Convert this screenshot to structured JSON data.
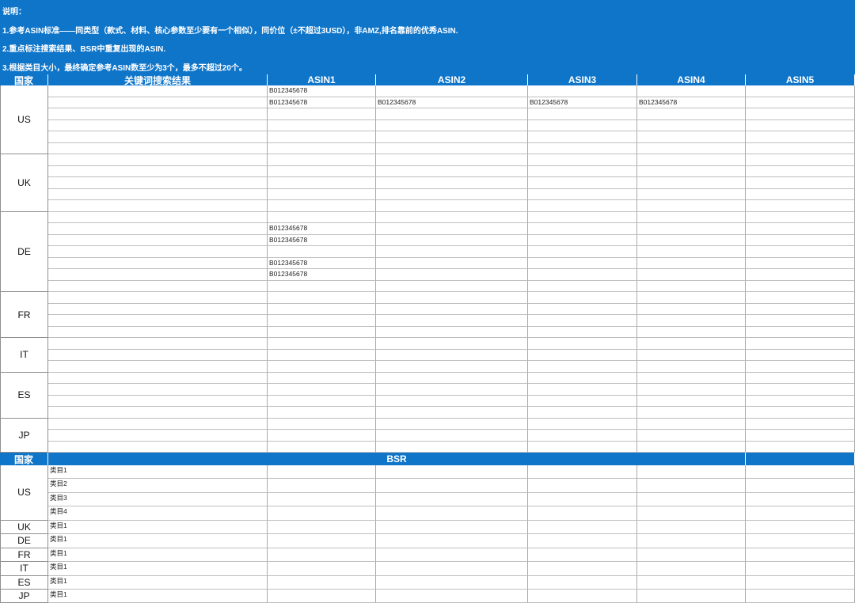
{
  "notes": {
    "title": "说明：",
    "line1": "1.参考ASIN标准——同类型（款式、材料、核心参数至少要有一个相似），同价位（±不超过3USD），非AMZ,排名靠前的优秀ASIN.",
    "line2": "2.重点标注搜索结果、BSR中重复出现的ASIN.",
    "line3": "3.根据类目大小，最终确定参考ASIN数至少为3个，最多不超过20个。"
  },
  "table1": {
    "headers": [
      "国家",
      "关键词搜索结果",
      "ASIN1",
      "ASIN2",
      "ASIN3",
      "ASIN4",
      "ASIN5"
    ],
    "groups": [
      {
        "country": "US",
        "rows": [
          [
            "",
            "B012345678",
            "",
            "",
            "",
            ""
          ],
          [
            "",
            "B012345678",
            "B012345678",
            "B012345678",
            "B012345678",
            ""
          ],
          [
            "",
            "",
            "",
            "",
            "",
            ""
          ],
          [
            "",
            "",
            "",
            "",
            "",
            ""
          ],
          [
            "",
            "",
            "",
            "",
            "",
            ""
          ],
          [
            "",
            "",
            "",
            "",
            "",
            ""
          ]
        ]
      },
      {
        "country": "UK",
        "rows": [
          [
            "",
            "",
            "",
            "",
            "",
            ""
          ],
          [
            "",
            "",
            "",
            "",
            "",
            ""
          ],
          [
            "",
            "",
            "",
            "",
            "",
            ""
          ],
          [
            "",
            "",
            "",
            "",
            "",
            ""
          ],
          [
            "",
            "",
            "",
            "",
            "",
            ""
          ]
        ]
      },
      {
        "country": "DE",
        "rows": [
          [
            "",
            "",
            "",
            "",
            "",
            ""
          ],
          [
            "",
            "B012345678",
            "",
            "",
            "",
            ""
          ],
          [
            "",
            "B012345678",
            "",
            "",
            "",
            ""
          ],
          [
            "",
            "",
            "",
            "",
            "",
            ""
          ],
          [
            "",
            "B012345678",
            "",
            "",
            "",
            ""
          ],
          [
            "",
            "B012345678",
            "",
            "",
            "",
            ""
          ],
          [
            "",
            "",
            "",
            "",
            "",
            ""
          ]
        ]
      },
      {
        "country": "FR",
        "rows": [
          [
            "",
            "",
            "",
            "",
            "",
            ""
          ],
          [
            "",
            "",
            "",
            "",
            "",
            ""
          ],
          [
            "",
            "",
            "",
            "",
            "",
            ""
          ],
          [
            "",
            "",
            "",
            "",
            "",
            ""
          ]
        ]
      },
      {
        "country": "IT",
        "rows": [
          [
            "",
            "",
            "",
            "",
            "",
            ""
          ],
          [
            "",
            "",
            "",
            "",
            "",
            ""
          ],
          [
            "",
            "",
            "",
            "",
            "",
            ""
          ]
        ]
      },
      {
        "country": "ES",
        "rows": [
          [
            "",
            "",
            "",
            "",
            "",
            ""
          ],
          [
            "",
            "",
            "",
            "",
            "",
            ""
          ],
          [
            "",
            "",
            "",
            "",
            "",
            ""
          ],
          [
            "",
            "",
            "",
            "",
            "",
            ""
          ]
        ]
      },
      {
        "country": "JP",
        "rows": [
          [
            "",
            "",
            "",
            "",
            "",
            ""
          ],
          [
            "",
            "",
            "",
            "",
            "",
            ""
          ],
          [
            "",
            "",
            "",
            "",
            "",
            ""
          ]
        ]
      }
    ]
  },
  "table2": {
    "headers": [
      "国家",
      "BSR"
    ],
    "groups": [
      {
        "country": "US",
        "rows": [
          [
            "类目1",
            "",
            "",
            "",
            "",
            ""
          ],
          [
            "类目2",
            "",
            "",
            "",
            "",
            ""
          ],
          [
            "类目3",
            "",
            "",
            "",
            "",
            ""
          ],
          [
            "类目4",
            "",
            "",
            "",
            "",
            ""
          ]
        ]
      },
      {
        "country": "UK",
        "rows": [
          [
            "类目1",
            "",
            "",
            "",
            "",
            ""
          ]
        ]
      },
      {
        "country": "DE",
        "rows": [
          [
            "类目1",
            "",
            "",
            "",
            "",
            ""
          ]
        ]
      },
      {
        "country": "FR",
        "rows": [
          [
            "类目1",
            "",
            "",
            "",
            "",
            ""
          ]
        ]
      },
      {
        "country": "IT",
        "rows": [
          [
            "类目1",
            "",
            "",
            "",
            "",
            ""
          ]
        ]
      },
      {
        "country": "ES",
        "rows": [
          [
            "类目1",
            "",
            "",
            "",
            "",
            ""
          ]
        ]
      },
      {
        "country": "JP",
        "rows": [
          [
            "类目1",
            "",
            "",
            "",
            "",
            ""
          ]
        ]
      }
    ]
  }
}
